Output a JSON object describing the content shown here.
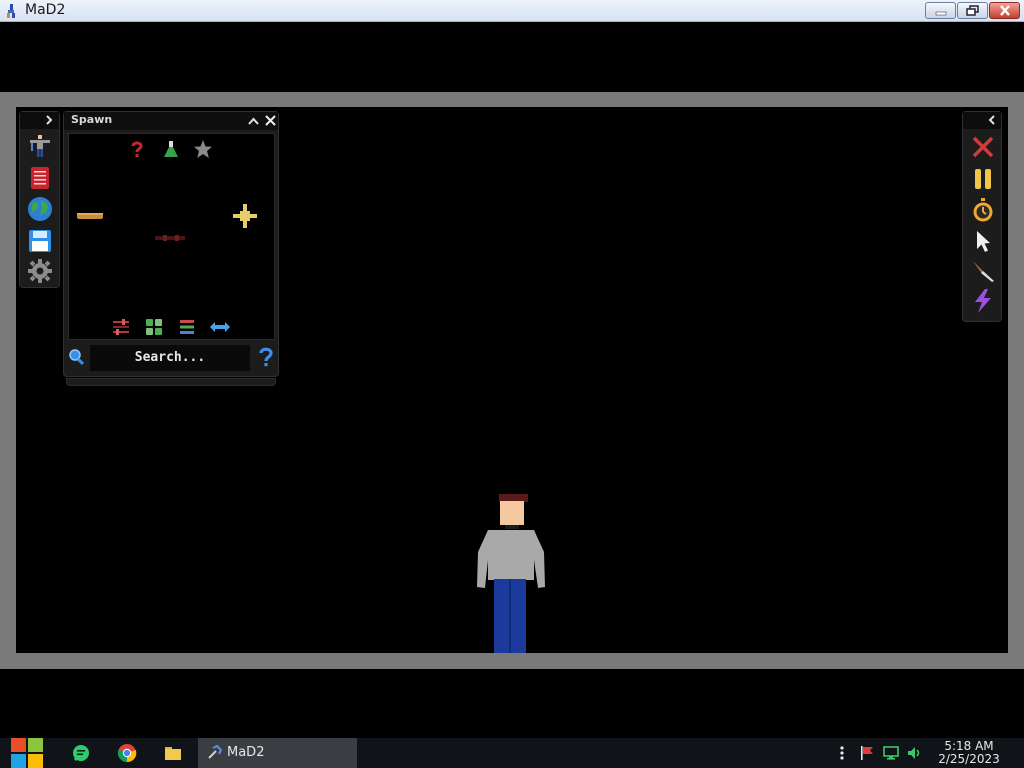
{
  "window": {
    "title": "MaD2",
    "icon": "mad2-app-icon",
    "controls": [
      "minimize-icon",
      "maximize-icon",
      "close-icon"
    ]
  },
  "left_toolbar": {
    "toggle_icon": "chevron-right-icon",
    "items": [
      {
        "name": "character-pose",
        "icon": "character-pose-icon"
      },
      {
        "name": "notebook",
        "icon": "notebook-icon"
      },
      {
        "name": "world",
        "icon": "globe-icon"
      },
      {
        "name": "save",
        "icon": "floppy-save-icon"
      },
      {
        "name": "settings",
        "icon": "gear-icon"
      }
    ]
  },
  "spawn_panel": {
    "title": "Spawn",
    "collapse_icon": "chevron-up-icon",
    "close_icon": "close-icon",
    "categories": [
      {
        "icon": "question-mark-icon",
        "color": "#c8242f"
      },
      {
        "icon": "flask-icon",
        "color": "#3aa34a"
      },
      {
        "icon": "star-icon",
        "color": "#8a8a8a"
      }
    ],
    "items": [
      {
        "icon": "wooden-plank-icon",
        "color": "#c98c3a"
      },
      {
        "icon": "dark-rod-icon",
        "color": "#5a1a1a"
      },
      {
        "icon": "yellow-connector-icon",
        "color": "#e6cc6a"
      }
    ],
    "bottom_tools": [
      {
        "icon": "sliders-icon",
        "color": "#b23a3a"
      },
      {
        "icon": "grid-icon",
        "color": "#4caf50"
      },
      {
        "icon": "list-icon",
        "color": "#4f7fd6"
      },
      {
        "icon": "resize-horizontal-icon",
        "color": "#4aa3e6"
      }
    ],
    "search": {
      "placeholder": "Search...",
      "search_icon": "magnifier-icon",
      "help_icon": "help-icon"
    }
  },
  "right_toolbar": {
    "toggle_icon": "chevron-left-icon",
    "items": [
      {
        "name": "clear",
        "icon": "red-x-icon",
        "color": "#d33a3a"
      },
      {
        "name": "pause",
        "icon": "pause-icon",
        "color": "#f0c64a"
      },
      {
        "name": "timer",
        "icon": "stopwatch-icon",
        "color": "#f0a830"
      },
      {
        "name": "select",
        "icon": "cursor-arrow-icon",
        "color": "#e8e8e8"
      },
      {
        "name": "knife",
        "icon": "knife-icon",
        "color": "#c9a36a"
      },
      {
        "name": "lightning",
        "icon": "lightning-icon",
        "color": "#9b4fe0"
      }
    ]
  },
  "taskbar": {
    "start_icon": "windows-logo-icon",
    "pinned": [
      {
        "icon": "chat-app-icon",
        "color": "#2ecc71"
      },
      {
        "icon": "chrome-icon",
        "color": "#db4437"
      },
      {
        "icon": "file-explorer-icon",
        "color": "#f2c94c"
      }
    ],
    "active_task": {
      "label": "MaD2",
      "icon": "mad2-app-icon"
    },
    "tray": [
      "more-icon",
      "flag-icon",
      "network-icon",
      "speaker-icon"
    ],
    "clock": {
      "time": "5:18 AM",
      "date": "2/25/2023"
    }
  },
  "colors": {
    "frame": "#7a7a7a",
    "arena": "#000000",
    "panel": "#1c1c1c",
    "shirt": "#a9a9a9",
    "pants": "#1b3a9c",
    "skin": "#f4c9a0",
    "hair": "#5a1a1a"
  }
}
